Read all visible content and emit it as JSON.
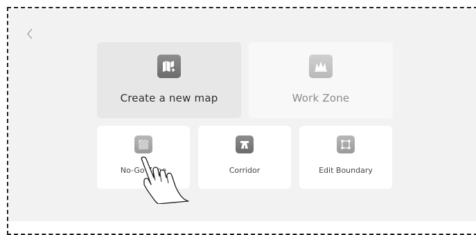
{
  "nav": {
    "back_icon": "chevron-left-icon"
  },
  "primary_cards": [
    {
      "label": "Create a new map",
      "icon": "map-plus-icon",
      "state": "selected"
    },
    {
      "label": "Work Zone",
      "icon": "grass-icon",
      "state": "normal"
    }
  ],
  "secondary_cards": [
    {
      "label": "No-Go Zone",
      "icon": "no-go-zone-icon"
    },
    {
      "label": "Corridor",
      "icon": "corridor-icon"
    },
    {
      "label": "Edit Boundary",
      "icon": "edit-boundary-icon"
    }
  ],
  "overlay": {
    "icon": "tap-hand-icon"
  }
}
